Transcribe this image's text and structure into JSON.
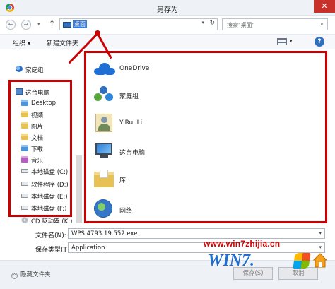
{
  "window": {
    "title": "另存为",
    "close_label": "✕",
    "app_icon": "chrome-icon"
  },
  "address": {
    "back_glyph": "←",
    "forward_glyph": "→",
    "recent_glyph": "▾",
    "up_glyph": "↑",
    "path": "桌面",
    "dropdown_glyph": "▾",
    "refresh_glyph": "↻",
    "search_placeholder": "搜索\"桌面\"",
    "search_glyph": "⌕"
  },
  "toolbar": {
    "organize_label": "组织 ▾",
    "new_folder_label": "新建文件夹",
    "view_dropdown_glyph": "▾",
    "help_glyph": "?"
  },
  "nav": {
    "homegroup": "家庭组",
    "this_pc": "这台电脑",
    "items": [
      {
        "label": "Desktop",
        "icon": "folder-blue-icon"
      },
      {
        "label": "视频",
        "icon": "folder-video-icon"
      },
      {
        "label": "图片",
        "icon": "folder-pictures-icon"
      },
      {
        "label": "文档",
        "icon": "folder-documents-icon"
      },
      {
        "label": "下载",
        "icon": "folder-downloads-icon"
      },
      {
        "label": "音乐",
        "icon": "folder-music-icon"
      },
      {
        "label": "本地磁盘 (C:)",
        "icon": "drive-icon"
      },
      {
        "label": "软件程序 (D:)",
        "icon": "drive-icon"
      },
      {
        "label": "本地磁盘 (E:)",
        "icon": "drive-icon"
      },
      {
        "label": "本地磁盘 (F:)",
        "icon": "drive-icon"
      },
      {
        "label": "CD 驱动器 (K:)",
        "icon": "cd-drive-icon"
      }
    ]
  },
  "content": {
    "items": [
      {
        "label": "OneDrive",
        "icon": "onedrive-icon"
      },
      {
        "label": "家庭组",
        "icon": "homegroup-icon"
      },
      {
        "label": "YiRui Li",
        "icon": "user-folder-icon"
      },
      {
        "label": "这台电脑",
        "icon": "computer-icon"
      },
      {
        "label": "库",
        "icon": "library-icon"
      },
      {
        "label": "网络",
        "icon": "network-icon"
      }
    ]
  },
  "form": {
    "filename_label": "文件名(N):",
    "filename_value": "WPS.4793.19.552.exe",
    "filetype_label": "保存类型(T):",
    "filetype_value": "Application",
    "dropdown_glyph": "▾"
  },
  "footer": {
    "hide_folders_label": "隐藏文件夹",
    "hide_folders_glyph": "^",
    "save_label": "保存(S)",
    "cancel_label": "取消"
  },
  "watermark": {
    "url": "www.win7zhijia.cn",
    "logo": "WIN7.",
    "logo_mark": "windows-flag-icon"
  },
  "colors": {
    "annotation_red": "#cc0000",
    "selection_blue": "#3a7bd5",
    "close_red": "#c7312a"
  }
}
